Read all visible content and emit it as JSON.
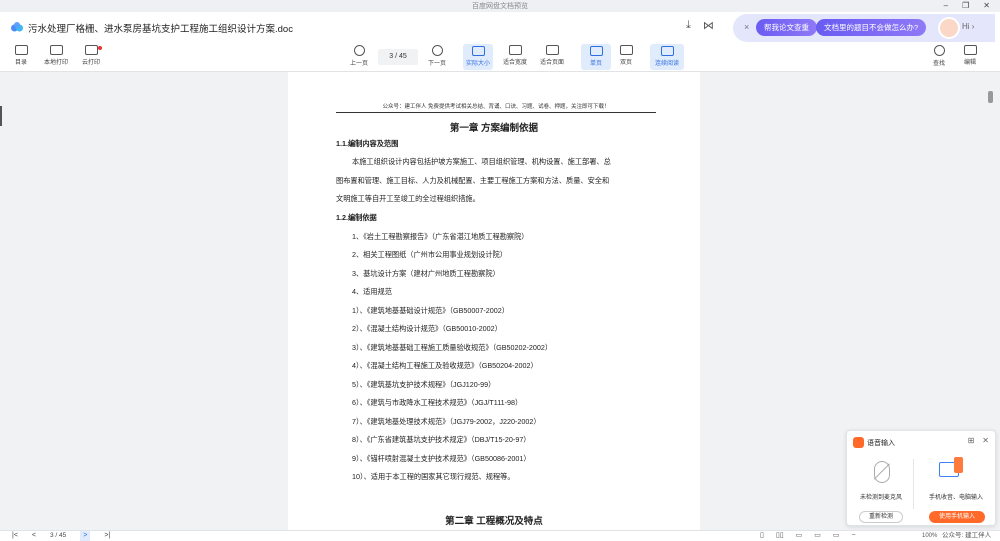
{
  "app": {
    "title": "百度网盘文档预览"
  },
  "window": {
    "minimize": "–",
    "restore": "❐",
    "close": "✕"
  },
  "doc": {
    "title": "污水处理厂格栅、进水泵房基坑支护工程施工组织设计方案.doc"
  },
  "ai": {
    "close": "×",
    "pill1": "帮我论文查重",
    "pill2": "文档里的题目不会做怎么办?",
    "hi": "Hi ›"
  },
  "toolbar": {
    "toc": "目录",
    "local_print": "本地打印",
    "cloud_print": "云打印",
    "prev": "上一页",
    "page_indicator": "3 / 45",
    "next": "下一页",
    "actual_size": "实际大小",
    "fit_width": "适合宽度",
    "fit_page": "适合页面",
    "single": "单页",
    "double": "双页",
    "continuous": "连续阅读",
    "find": "查找",
    "edit": "编辑"
  },
  "page": {
    "header": "公众号：建工伴人 免费提供考试相关总结、背诵、口诀、习题、试卷、押题，关注即可下载！",
    "chapter1": "第一章  方案编制依据",
    "s11": "1.1.编制内容及范围",
    "p1": "本施工组织设计内容包括护坡方案施工、项目组织管理、机构设置、施工部署、总",
    "p2": "图布置和管理、施工目标、人力及机械配置、主要工程施工方案和方法、质量、安全和",
    "p3": "文明施工等自开工至竣工的全过程组织措施。",
    "s12": "1.2.编制依据",
    "items": [
      "1、《岩土工程勘察报告》（广东省湛江地质工程勘察院）",
      "2、相关工程图纸（广州市公用事业规划设计院）",
      "3、基坑设计方案（建材广州地质工程勘察院）",
      "4、适用规范",
      "1）、《建筑地基基础设计规范》（GB50007-2002）",
      "2）、《混凝土结构设计规范》（GB50010-2002）",
      "3）、《建筑地基基础工程施工质量验收规范》（GB50202-2002）",
      "4）、《混凝土结构工程施工及验收规范》（GB50204-2002）",
      "5）、《建筑基坑支护技术规程》（JGJ120-99）",
      "6）、《建筑与市政降水工程技术规范》（JGJ/T111-98）",
      "7）、《建筑地基处理技术规范》（JGJ79-2002，J220-2002）",
      "8）、《广东省建筑基坑支护技术规定》（DBJ/T15-20-97）",
      "9）、《锚杆喷射混凝土支护技术规范》（GB50086-2001）",
      "10）、适用于本工程的国家其它现行规范、规程等。"
    ],
    "chapter2": "第二章  工程概况及特点"
  },
  "voice": {
    "title": "语音输入",
    "no_mic": "未检测到麦克风",
    "phone_pc": "手机收音、电脑输入",
    "recheck": "重新检测",
    "use_phone": "使用手机输入"
  },
  "status": {
    "page": "3 / 45",
    "zoom": "100%",
    "watermark": "公众号: 建工伴人"
  },
  "colors": {
    "accent": "#2f6ee0",
    "ai_pill": "#7b68f5",
    "voice_orange": "#ff6a2b"
  }
}
